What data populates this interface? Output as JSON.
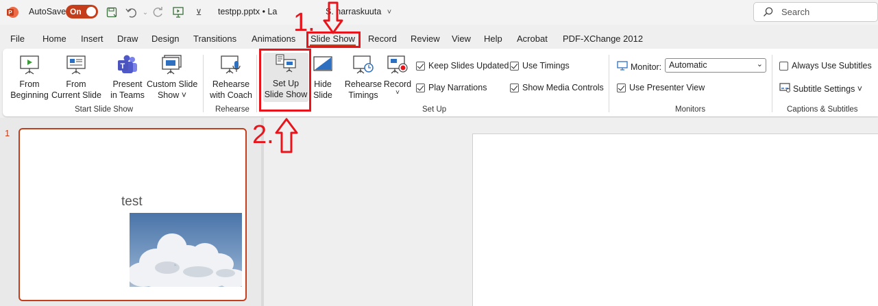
{
  "titlebar": {
    "autosave_label": "AutoSave",
    "autosave_state": "On",
    "doc_title": "testpp.pptx  •  La",
    "doc_name": "S. harraskuuta",
    "search_placeholder": "Search"
  },
  "menu": {
    "tabs": [
      "File",
      "Home",
      "Insert",
      "Draw",
      "Design",
      "Transitions",
      "Animations",
      "Slide Show",
      "Record",
      "Review",
      "View",
      "Help",
      "Acrobat",
      "PDF-XChange 2012"
    ],
    "active_tab": "Slide Show"
  },
  "ribbon": {
    "start": {
      "from_beginning": [
        "From",
        "Beginning"
      ],
      "from_current": [
        "From",
        "Current Slide"
      ],
      "present_teams": [
        "Present",
        "in Teams"
      ],
      "custom": [
        "Custom Slide",
        "Show ˅"
      ],
      "group_label": "Start Slide Show"
    },
    "rehearse": {
      "coach": [
        "Rehearse",
        "with Coach"
      ],
      "group_label": "Rehearse"
    },
    "setup": {
      "setup_show": [
        "Set Up",
        "Slide Show"
      ],
      "hide_slide": [
        "Hide",
        "Slide"
      ],
      "timings": [
        "Rehearse",
        "Timings"
      ],
      "record": [
        "Record",
        "˅"
      ],
      "keep_updated": "Keep Slides Updated",
      "play_narrations": "Play Narrations",
      "use_timings": "Use Timings",
      "show_media": "Show Media Controls",
      "group_label": "Set Up"
    },
    "monitors": {
      "monitor_label": "Monitor:",
      "monitor_value": "Automatic",
      "presenter_view": "Use Presenter View",
      "group_label": "Monitors"
    },
    "captions": {
      "always_subtitles": "Always Use Subtitles",
      "subtitle_settings": "Subtitle Settings ˅",
      "group_label": "Captions & Subtitles"
    }
  },
  "slides": {
    "number": "1",
    "thumb_title": "test"
  },
  "annotations": {
    "step1": "1.",
    "step2": "2."
  },
  "colors": {
    "accent": "#c43e1c",
    "annotation": "#e8141b"
  }
}
